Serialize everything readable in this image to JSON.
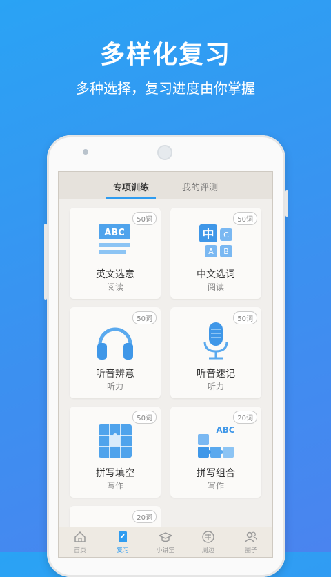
{
  "promo": {
    "title": "多样化复习",
    "subtitle": "多种选择，复习进度由你掌握"
  },
  "tabs": [
    {
      "label": "专项训练",
      "active": true
    },
    {
      "label": "我的评测",
      "active": false
    }
  ],
  "cards": [
    {
      "title": "英文选意",
      "subtitle": "阅读",
      "badge": "50词",
      "icon": "abc-text-icon"
    },
    {
      "title": "中文选词",
      "subtitle": "阅读",
      "badge": "50词",
      "icon": "chinese-abc-blocks-icon"
    },
    {
      "title": "听音辨意",
      "subtitle": "听力",
      "badge": "50词",
      "icon": "headphones-icon"
    },
    {
      "title": "听音速记",
      "subtitle": "听力",
      "badge": "50词",
      "icon": "microphone-icon"
    },
    {
      "title": "拼写填空",
      "subtitle": "写作",
      "badge": "50词",
      "icon": "puzzle-grid-icon"
    },
    {
      "title": "拼写组合",
      "subtitle": "写作",
      "badge": "20词",
      "icon": "puzzle-abc-icon"
    },
    {
      "title": "",
      "subtitle": "",
      "badge": "20词",
      "icon": ""
    }
  ],
  "icon_text": {
    "abc": "ABC",
    "zhong": "中",
    "c": "C",
    "a": "A",
    "b": "B"
  },
  "bottom_nav": [
    {
      "label": "首页",
      "icon": "home-icon",
      "active": false
    },
    {
      "label": "复习",
      "icon": "review-icon",
      "active": true
    },
    {
      "label": "小讲堂",
      "icon": "graduation-cap-icon",
      "active": false
    },
    {
      "label": "周边",
      "icon": "tao-icon",
      "active": false
    },
    {
      "label": "圈子",
      "icon": "friends-icon",
      "active": false
    }
  ],
  "colors": {
    "background": "#3d8ff0",
    "accent": "#2f9cf0",
    "icon_blue": "#5aa9ee"
  }
}
